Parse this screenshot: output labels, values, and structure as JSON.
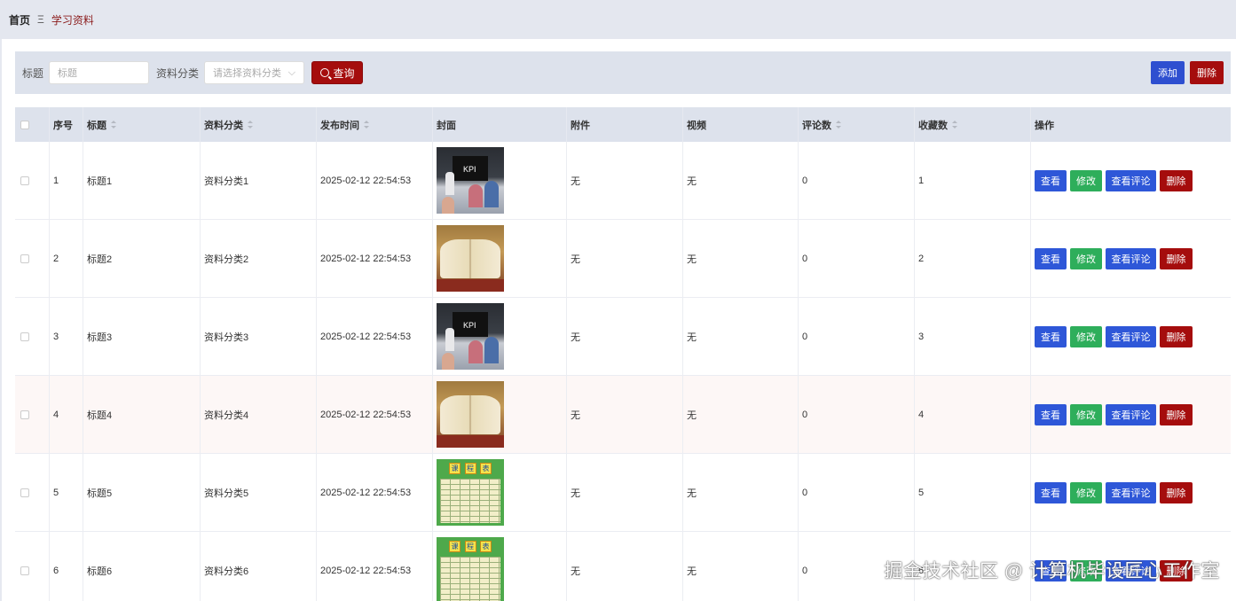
{
  "breadcrumb": {
    "home": "首页",
    "separator": "Ξ",
    "current": "学习资料"
  },
  "search": {
    "title_label": "标题",
    "title_placeholder": "标题",
    "category_label": "资料分类",
    "category_placeholder": "请选择资料分类",
    "query_button": "查询"
  },
  "toolbar": {
    "add": "添加",
    "delete": "删除"
  },
  "table": {
    "columns": [
      "序号",
      "标题",
      "资料分类",
      "发布时间",
      "封面",
      "附件",
      "视频",
      "评论数",
      "收藏数",
      "操作"
    ],
    "row_buttons": {
      "view": "查看",
      "edit": "修改",
      "comments": "查看评论",
      "delete": "删除"
    },
    "rows": [
      {
        "no": "1",
        "title": "标题1",
        "category": "资料分类1",
        "time": "2025-02-12 22:54:53",
        "cover": "meeting",
        "attachment": "无",
        "video": "无",
        "comments": "0",
        "favorites": "1"
      },
      {
        "no": "2",
        "title": "标题2",
        "category": "资料分类2",
        "time": "2025-02-12 22:54:53",
        "cover": "book",
        "attachment": "无",
        "video": "无",
        "comments": "0",
        "favorites": "2"
      },
      {
        "no": "3",
        "title": "标题3",
        "category": "资料分类3",
        "time": "2025-02-12 22:54:53",
        "cover": "meeting",
        "attachment": "无",
        "video": "无",
        "comments": "0",
        "favorites": "3"
      },
      {
        "no": "4",
        "title": "标题4",
        "category": "资料分类4",
        "time": "2025-02-12 22:54:53",
        "cover": "book",
        "attachment": "无",
        "video": "无",
        "comments": "0",
        "favorites": "4"
      },
      {
        "no": "5",
        "title": "标题5",
        "category": "资料分类5",
        "time": "2025-02-12 22:54:53",
        "cover": "schedule",
        "attachment": "无",
        "video": "无",
        "comments": "0",
        "favorites": "5"
      },
      {
        "no": "6",
        "title": "标题6",
        "category": "资料分类6",
        "time": "2025-02-12 22:54:53",
        "cover": "schedule",
        "attachment": "无",
        "video": "无",
        "comments": "0",
        "favorites": "6"
      }
    ]
  },
  "cover_text": {
    "kpi": "KPI",
    "schedule_header": [
      "课",
      "程",
      "表"
    ]
  },
  "watermark": "掘金技术社区 @ 计算机毕设匠心工作室"
}
